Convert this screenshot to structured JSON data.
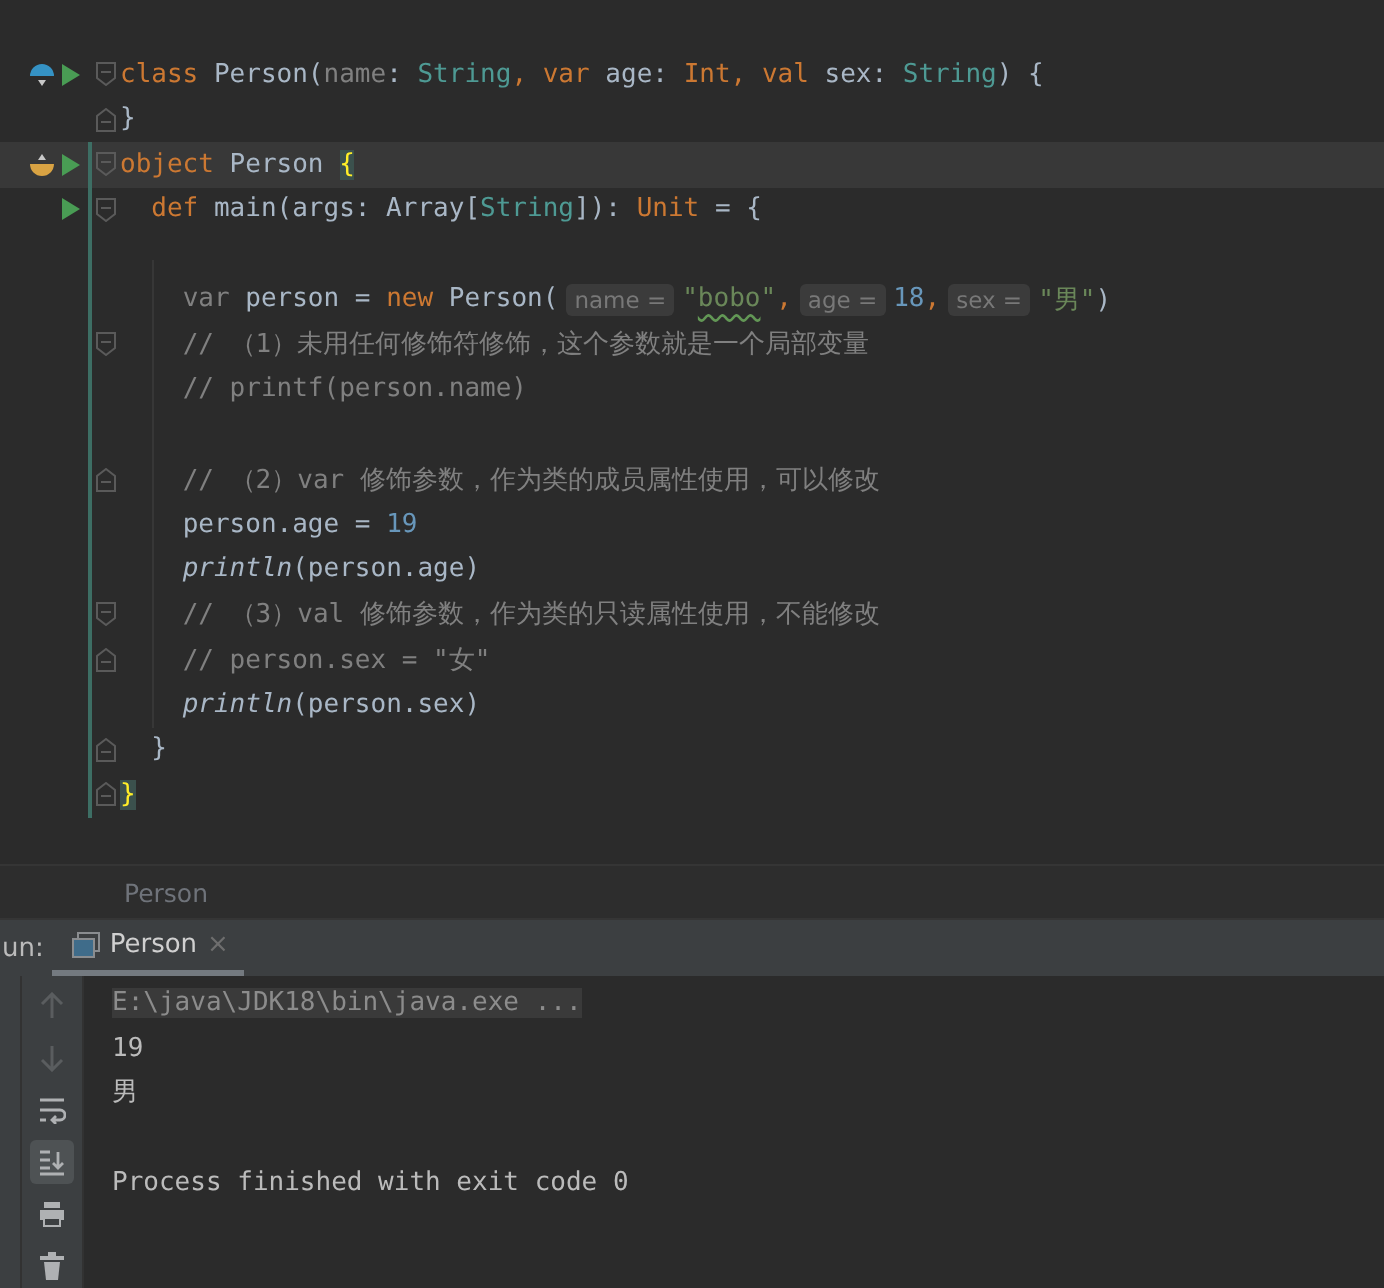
{
  "editor": {
    "lines": [
      {
        "markers": [
          {
            "kind": "overridden"
          },
          {
            "kind": "run"
          }
        ],
        "fold": {
          "kind": "start"
        },
        "current": false,
        "tokens": [
          {
            "text": "class",
            "kind": "keyword"
          },
          {
            "text": " Person(",
            "kind": "plain"
          },
          {
            "text": "name",
            "kind": "unused"
          },
          {
            "text": ": ",
            "kind": "plain"
          },
          {
            "text": "String",
            "kind": "type"
          },
          {
            "text": ", ",
            "kind": "keyword"
          },
          {
            "text": "var",
            "kind": "keyword"
          },
          {
            "text": " age: ",
            "kind": "plain"
          },
          {
            "text": "Int",
            "kind": "keyword"
          },
          {
            "text": ", ",
            "kind": "keyword"
          },
          {
            "text": "val",
            "kind": "keyword"
          },
          {
            "text": " sex: ",
            "kind": "plain"
          },
          {
            "text": "String",
            "kind": "type"
          },
          {
            "text": ") {",
            "kind": "plain"
          }
        ]
      },
      {
        "fold": {
          "kind": "end"
        },
        "current": false,
        "tokens": [
          {
            "text": "}",
            "kind": "plain"
          }
        ]
      },
      {
        "markers": [
          {
            "kind": "implemented"
          },
          {
            "kind": "run"
          }
        ],
        "fold": {
          "kind": "start"
        },
        "current": true,
        "tokens": [
          {
            "text": "object",
            "kind": "keyword"
          },
          {
            "text": " Person ",
            "kind": "plain"
          },
          {
            "text": "{",
            "kind": "brace-match"
          }
        ]
      },
      {
        "markers": [
          {
            "kind": "run"
          }
        ],
        "fold": {
          "kind": "start"
        },
        "current": false,
        "tokens": [
          {
            "text": "  def",
            "kind": "keyword"
          },
          {
            "text": " main(args: Array[",
            "kind": "plain"
          },
          {
            "text": "String",
            "kind": "type"
          },
          {
            "text": "]): ",
            "kind": "plain"
          },
          {
            "text": "Unit",
            "kind": "keyword"
          },
          {
            "text": " = {",
            "kind": "plain"
          }
        ]
      },
      {
        "current": false
      },
      {
        "current": false,
        "tokens": [
          {
            "text": "    var",
            "kind": "unused"
          },
          {
            "text": " person = ",
            "kind": "plain"
          },
          {
            "text": "new",
            "kind": "keyword"
          },
          {
            "text": " Person(",
            "kind": "plain"
          },
          {
            "text": "name =",
            "kind": "hint"
          },
          {
            "text": "\"",
            "kind": "string"
          },
          {
            "text": "bobo",
            "kind": "string-typo"
          },
          {
            "text": "\"",
            "kind": "string"
          },
          {
            "text": ",",
            "kind": "keyword"
          },
          {
            "text": "age =",
            "kind": "hint"
          },
          {
            "text": "18",
            "kind": "number"
          },
          {
            "text": ",",
            "kind": "keyword"
          },
          {
            "text": "sex =",
            "kind": "hint"
          },
          {
            "text": "\"男\"",
            "kind": "string"
          },
          {
            "text": ")",
            "kind": "plain"
          }
        ]
      },
      {
        "fold": {
          "kind": "start"
        },
        "current": false,
        "tokens": [
          {
            "text": "    // （1）未用任何修饰符修饰，这个参数就是一个局部变量",
            "kind": "comment"
          }
        ]
      },
      {
        "current": false,
        "tokens": [
          {
            "text": "    // printf(person.name)",
            "kind": "comment"
          }
        ]
      },
      {
        "current": false
      },
      {
        "fold": {
          "kind": "end"
        },
        "current": false,
        "tokens": [
          {
            "text": "    // （2）var 修饰参数，作为类的成员属性使用，可以修改",
            "kind": "comment"
          }
        ]
      },
      {
        "current": false,
        "tokens": [
          {
            "text": "    person.age = ",
            "kind": "plain"
          },
          {
            "text": "19",
            "kind": "number"
          }
        ]
      },
      {
        "current": false,
        "tokens": [
          {
            "text": "    println",
            "kind": "function"
          },
          {
            "text": "(person.age)",
            "kind": "plain"
          }
        ]
      },
      {
        "fold": {
          "kind": "start"
        },
        "current": false,
        "tokens": [
          {
            "text": "    // （3）val 修饰参数，作为类的只读属性使用，不能修改",
            "kind": "comment"
          }
        ]
      },
      {
        "fold": {
          "kind": "end"
        },
        "current": false,
        "tokens": [
          {
            "text": "    // person.sex = \"女\"",
            "kind": "comment"
          }
        ]
      },
      {
        "current": false,
        "tokens": [
          {
            "text": "    println",
            "kind": "function"
          },
          {
            "text": "(person.sex)",
            "kind": "plain"
          }
        ]
      },
      {
        "fold": {
          "kind": "end"
        },
        "current": false,
        "tokens": [
          {
            "text": "  }",
            "kind": "plain"
          }
        ]
      },
      {
        "fold": {
          "kind": "end"
        },
        "current": false,
        "tokens": [
          {
            "text": "}",
            "kind": "brace-match"
          }
        ]
      }
    ]
  },
  "breadcrumb": {
    "items": [
      "Person"
    ]
  },
  "run_panel": {
    "label": "un:",
    "tabs": [
      {
        "label": "Person",
        "selected": true,
        "close": "×"
      }
    ],
    "tools": [
      {
        "kind": "up",
        "disabled": true,
        "selected": false
      },
      {
        "kind": "down",
        "disabled": true,
        "selected": false
      },
      {
        "kind": "wrap",
        "disabled": false,
        "selected": false
      },
      {
        "kind": "scroll-end",
        "disabled": false,
        "selected": true
      },
      {
        "kind": "print",
        "disabled": false,
        "selected": false
      },
      {
        "kind": "trash",
        "disabled": false,
        "selected": false
      }
    ],
    "console": [
      {
        "text": "E:\\java\\JDK18\\bin\\java.exe ...",
        "kind": "command"
      },
      {
        "text": "19",
        "kind": "output"
      },
      {
        "text": "男",
        "kind": "output"
      },
      {
        "text": "Process finished with exit code 0",
        "kind": "exit"
      }
    ]
  }
}
